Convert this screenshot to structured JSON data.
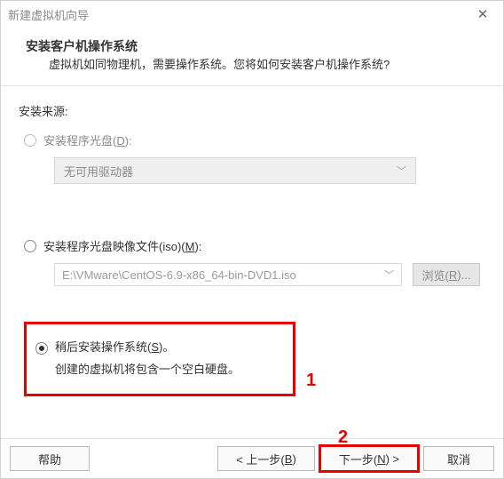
{
  "window": {
    "title": "新建虚拟机向导",
    "close_glyph": "✕"
  },
  "header": {
    "title": "安装客户机操作系统",
    "subtitle": "虚拟机如同物理机，需要操作系统。您将如何安装客户机操作系统?"
  },
  "source": {
    "label": "安装来源:"
  },
  "option_disc": {
    "label_pre": "安装程序光盘(",
    "label_u": "D",
    "label_post": "):",
    "drive_text": "无可用驱动器",
    "chevron": "﹀"
  },
  "option_iso": {
    "label_pre": "安装程序光盘映像文件(iso)(",
    "label_u": "M",
    "label_post": "):",
    "path": "E:\\VMware\\CentOS-6.9-x86_64-bin-DVD1.iso",
    "chevron": "﹀",
    "browse_pre": "浏览(",
    "browse_u": "R",
    "browse_post": ")..."
  },
  "option_later": {
    "label_pre": "稍后安装操作系统(",
    "label_u": "S",
    "label_post": ")。",
    "sub": "创建的虚拟机将包含一个空白硬盘。"
  },
  "annotations": {
    "one": "1",
    "two": "2"
  },
  "footer": {
    "help": "帮助",
    "back_pre": "< 上一步(",
    "back_u": "B",
    "back_post": ")",
    "next_pre": "下一步(",
    "next_u": "N",
    "next_post": ") >",
    "cancel": "取消"
  }
}
